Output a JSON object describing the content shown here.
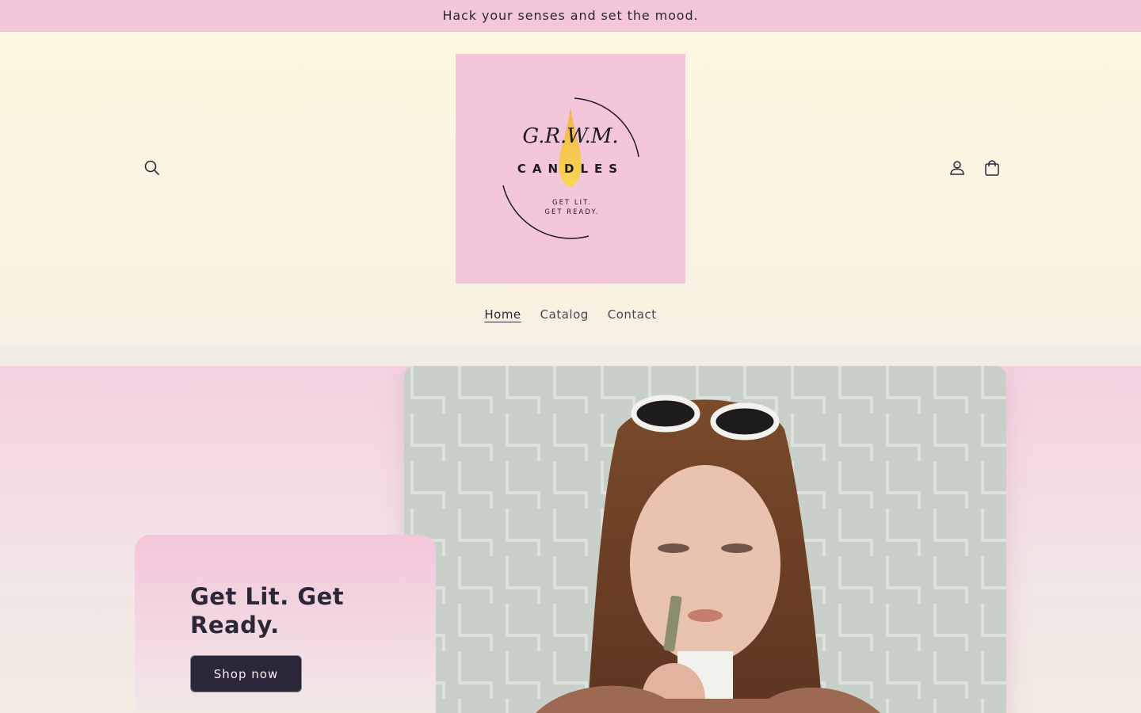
{
  "announcement": {
    "text": "Hack your senses and set the mood."
  },
  "header": {
    "logo": {
      "brand": "G.R.W.M.",
      "wordmark": "CANDLES",
      "tagline_1": "GET LIT.",
      "tagline_2": "GET READY."
    },
    "icons": {
      "search": "search-icon",
      "account": "account-icon",
      "cart": "cart-icon"
    }
  },
  "nav": {
    "items": [
      {
        "label": "Home",
        "active": true
      },
      {
        "label": "Catalog",
        "active": false
      },
      {
        "label": "Contact",
        "active": false
      }
    ]
  },
  "hero": {
    "heading": "Get Lit. Get Ready.",
    "button_label": "Shop now"
  },
  "colors": {
    "announcement_bg": "#f4c6da",
    "header_bg": "#fff6e1",
    "logo_bg": "#f4c6da",
    "button_bg": "#2b2738",
    "text": "#2b2738"
  }
}
